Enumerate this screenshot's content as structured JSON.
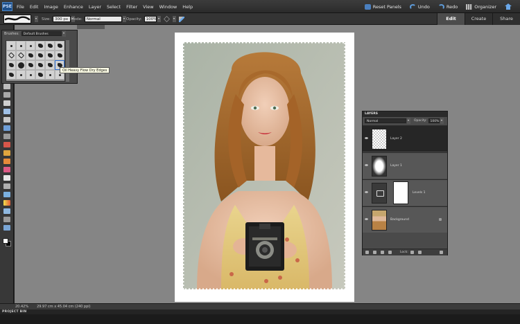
{
  "app": {
    "logo_text": "PSE"
  },
  "menu": [
    "File",
    "Edit",
    "Image",
    "Enhance",
    "Layer",
    "Select",
    "Filter",
    "View",
    "Window",
    "Help"
  ],
  "topbar": {
    "reset_panels": "Reset Panels",
    "undo": "Undo",
    "redo": "Redo",
    "organizer": "Organizer"
  },
  "tabs": [
    "Edit",
    "Create",
    "Share"
  ],
  "options": {
    "size_label": "Size:",
    "size_value": "300 px",
    "mode_label": "Mode:",
    "mode_value": "Normal",
    "opacity_label": "Opacity:",
    "opacity_value": "100%"
  },
  "brushes_panel": {
    "label": "Brushes:",
    "preset": "Default Brushes",
    "tooltip": "Oil Heavy Flow Dry Edges"
  },
  "layers_panel": {
    "title": "LAYERS",
    "blend_mode": "Normal",
    "opacity_label": "Opacity:",
    "opacity_value": "100%",
    "layers": [
      {
        "name": "Layer 2",
        "active": true
      },
      {
        "name": "Layer 1",
        "active": false
      },
      {
        "name": "Levels 1",
        "active": false
      },
      {
        "name": "Background",
        "active": false
      }
    ],
    "lock_label": "Lock:"
  },
  "status": {
    "zoom": "20.42%",
    "doc_info": "29.97 cm x 45.04 cm (240 ppi)"
  },
  "project_bin": {
    "label": "PROJECT BIN"
  }
}
